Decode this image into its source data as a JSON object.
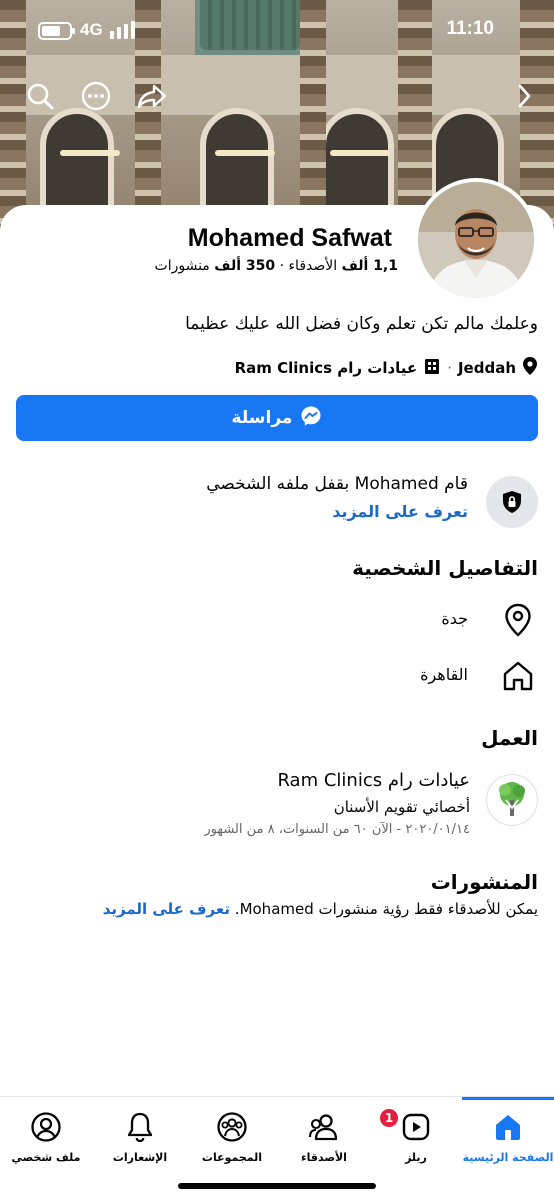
{
  "status_bar": {
    "network": "4G",
    "time": "11:10",
    "battery_level": 0.7
  },
  "cover": {
    "icons": [
      "search-icon",
      "more-icon",
      "share-icon",
      "chevron-right-icon"
    ]
  },
  "profile": {
    "name": "Mohamed Safwat",
    "stats": {
      "friends_count": "1,1 ألف",
      "friends_label": "الأصدقاء",
      "dot": "·",
      "posts_count": "350 ألف",
      "posts_label": "منشورات"
    },
    "bio": "وعلمك مالم تكن تعلم وكان فضل الله عليك عظيما",
    "location": "Jeddah",
    "workplace": "عيادات رام Ram Clinics",
    "message_button": "مراسلة"
  },
  "lock_notice": {
    "title": "قام Mohamed بقفل ملفه الشخصي",
    "link": "تعرف على المزيد"
  },
  "details": {
    "title": "التفاصيل الشخصية",
    "items": [
      {
        "icon": "location-pin-icon",
        "text": "جدة"
      },
      {
        "icon": "home-icon",
        "text": "القاهرة"
      }
    ]
  },
  "work": {
    "title": "العمل",
    "company": "عيادات رام Ram Clinics",
    "role": "أخصائي تقويم الأسنان",
    "dates": "٢٠٢٠/٠١/١٤ - الآن ٦٠ من السنوات، ٨ من الشهور"
  },
  "posts": {
    "title": "المنشورات",
    "text": "يمكن للأصدقاء فقط رؤية منشورات Mohamed.",
    "link": "تعرف على المزيد"
  },
  "bottom_nav": {
    "items": [
      {
        "label": "الصفحة الرئيسية",
        "icon": "home-icon",
        "active": true
      },
      {
        "label": "ريلز",
        "icon": "reels-icon",
        "badge": "1"
      },
      {
        "label": "الأصدقاء",
        "icon": "friends-icon"
      },
      {
        "label": "المجموعات",
        "icon": "groups-icon"
      },
      {
        "label": "الإشعارات",
        "icon": "bell-icon"
      },
      {
        "label": "ملف شخصي",
        "icon": "profile-icon"
      }
    ]
  },
  "colors": {
    "accent": "#1877f2",
    "link": "#1b6ac9",
    "badge": "#e41e3f",
    "muted": "#65676b"
  }
}
